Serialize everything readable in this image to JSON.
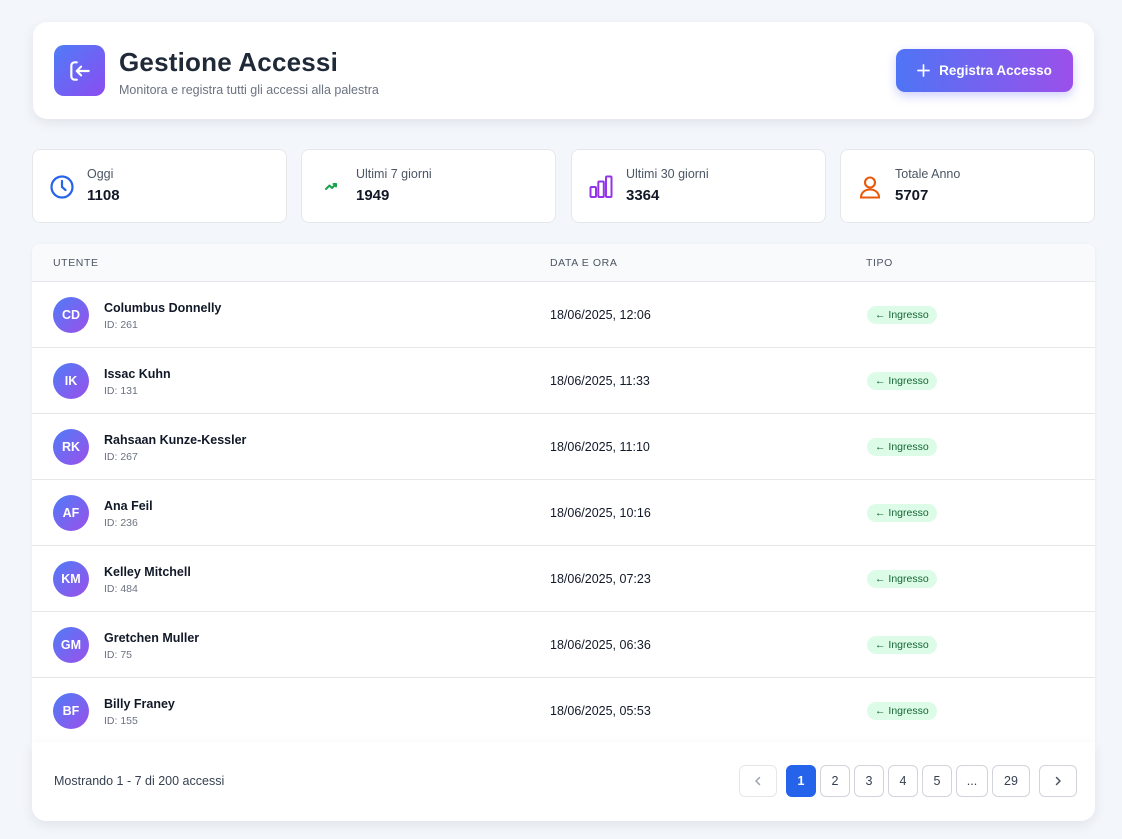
{
  "header": {
    "title": "Gestione Accessi",
    "subtitle": "Monitora e registra tutti gli accessi alla palestra",
    "primary_button_label": "Registra Accesso",
    "logo_icon": "login-arrow-icon",
    "accent_gradient": [
      "#4f7cf7",
      "#8b4cf0"
    ]
  },
  "stats": [
    {
      "label": "Oggi",
      "value": "1108",
      "icon": "clock-icon",
      "color": "#2563eb"
    },
    {
      "label": "Ultimi 7 giorni",
      "value": "1949",
      "icon": "trend-up-icon",
      "color": "#16a34a"
    },
    {
      "label": "Ultimi 30 giorni",
      "value": "3364",
      "icon": "bar-chart-icon",
      "color": "#9333ea"
    },
    {
      "label": "Totale Anno",
      "value": "5707",
      "icon": "user-icon",
      "color": "#ea580c"
    }
  ],
  "table": {
    "columns": [
      "UTENTE",
      "DATA E ORA",
      "TIPO"
    ],
    "rows": [
      {
        "initials": "CD",
        "name": "Columbus Donnelly",
        "id": "ID: 261",
        "datetime": "18/06/2025, 12:06",
        "type": "← Ingresso"
      },
      {
        "initials": "IK",
        "name": "Issac Kuhn",
        "id": "ID: 131",
        "datetime": "18/06/2025, 11:33",
        "type": "← Ingresso"
      },
      {
        "initials": "RK",
        "name": "Rahsaan Kunze-Kessler",
        "id": "ID: 267",
        "datetime": "18/06/2025, 11:10",
        "type": "← Ingresso"
      },
      {
        "initials": "AF",
        "name": "Ana Feil",
        "id": "ID: 236",
        "datetime": "18/06/2025, 10:16",
        "type": "← Ingresso"
      },
      {
        "initials": "KM",
        "name": "Kelley Mitchell",
        "id": "ID: 484",
        "datetime": "18/06/2025, 07:23",
        "type": "← Ingresso"
      },
      {
        "initials": "GM",
        "name": "Gretchen Muller",
        "id": "ID: 75",
        "datetime": "18/06/2025, 06:36",
        "type": "← Ingresso"
      },
      {
        "initials": "BF",
        "name": "Billy Franey",
        "id": "ID: 155",
        "datetime": "18/06/2025, 05:53",
        "type": "← Ingresso"
      }
    ]
  },
  "pagination": {
    "summary": "Mostrando 1 - 7 di 200 accessi",
    "prev_icon": "chevron-left-icon",
    "next_icon": "chevron-right-icon",
    "pages": [
      "1",
      "2",
      "3",
      "4",
      "5",
      "...",
      "29"
    ],
    "current": "1"
  }
}
